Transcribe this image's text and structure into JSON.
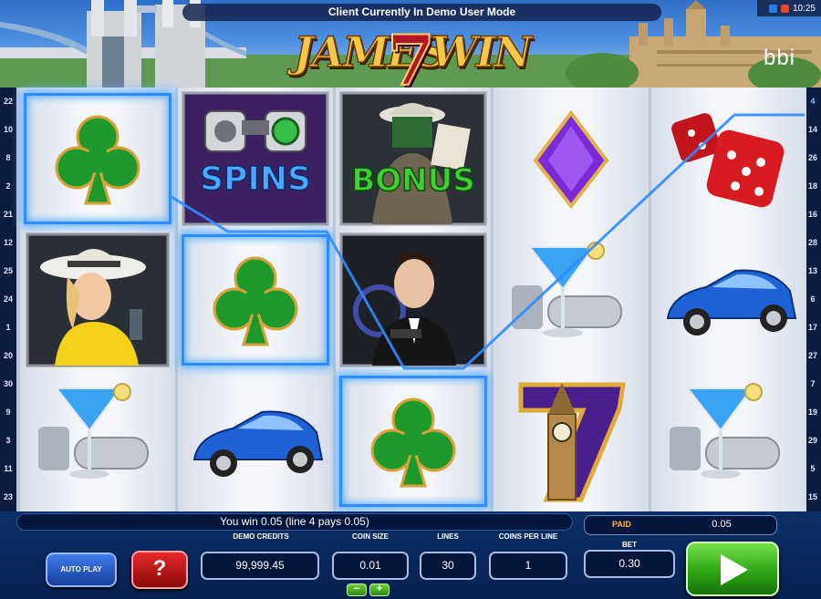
{
  "header": {
    "mode_banner": "Client Currently In Demo User Mode",
    "logo_left": "JAMES",
    "logo_seven": "7",
    "logo_right": "WIN",
    "brand": "bbi",
    "clock": "10:25"
  },
  "paylines": {
    "left": [
      "22",
      "10",
      "8",
      "2",
      "21",
      "12",
      "25",
      "24",
      "1",
      "20",
      "30",
      "9",
      "3",
      "11",
      "23"
    ],
    "right": [
      "4",
      "14",
      "26",
      "18",
      "16",
      "28",
      "13",
      "6",
      "17",
      "27",
      "7",
      "19",
      "29",
      "5",
      "15"
    ],
    "active_line": "4"
  },
  "reels": [
    [
      "club",
      "detective_woman",
      "martini"
    ],
    [
      "spins_binoculars",
      "club",
      "blue_car"
    ],
    [
      "bonus_spy",
      "james_agent",
      "club"
    ],
    [
      "purple_diamond",
      "martini",
      "seven_big_ben"
    ],
    [
      "red_dice",
      "blue_car",
      "martini"
    ]
  ],
  "symbol_text": {
    "spins": "SPINS",
    "bonus": "BONUS"
  },
  "win_message": "You win  0.05 (line 4 pays  0.05)",
  "console": {
    "paid_label": "PAID",
    "paid_value": "0.05",
    "auto_play_label": "AUTO PLAY",
    "help_label": "?",
    "demo_credits_label": "DEMO CREDITS",
    "demo_credits_value": "99,999.45",
    "coin_size_label": "COIN SIZE",
    "coin_size_value": "0.01",
    "lines_label": "LINES",
    "lines_value": "30",
    "coins_per_line_label": "COINS PER LINE",
    "coins_per_line_value": "1",
    "bet_label": "BET",
    "bet_value": "0.30",
    "minus_label": "−",
    "plus_label": "+"
  },
  "colors": {
    "highlight_frame": "#2f8cff",
    "console_bg": "#0b2f66",
    "paid_label": "#ffb04a",
    "spin_button": "#2fa515",
    "help_button": "#e52929",
    "autoplay_button": "#2a5fd0"
  }
}
